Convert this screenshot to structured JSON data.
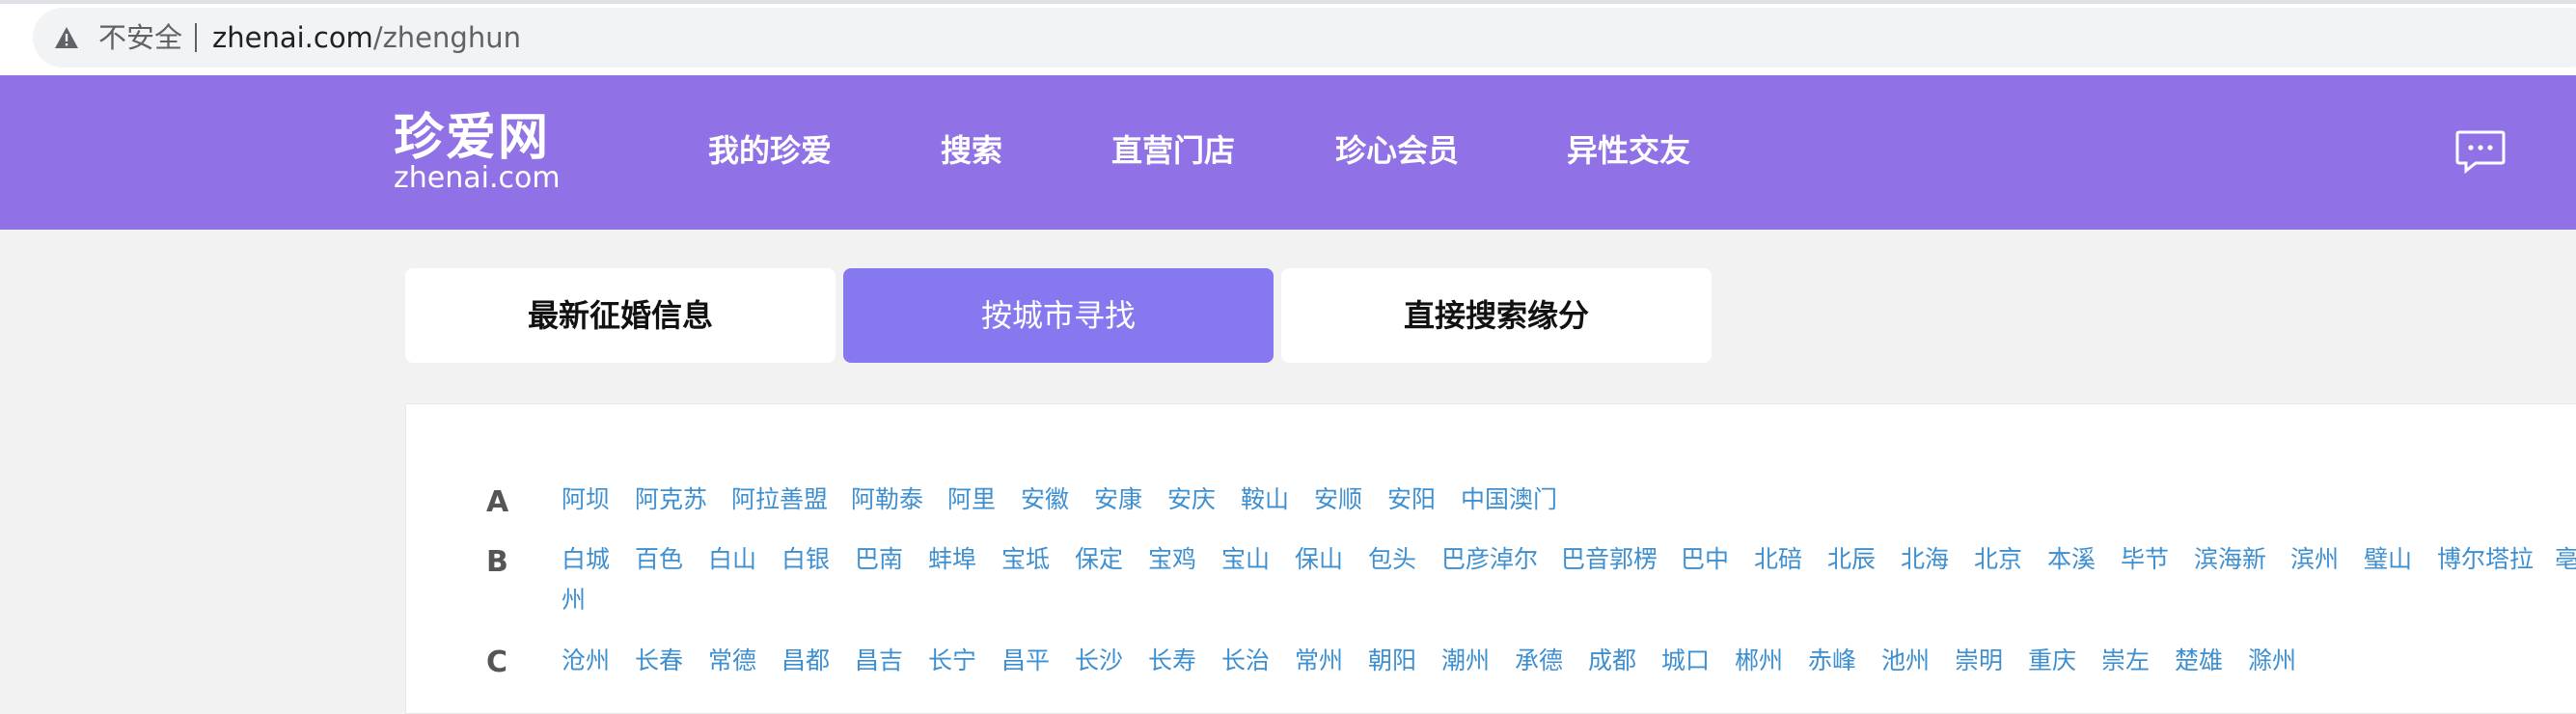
{
  "browser": {
    "security_label": "不安全",
    "url_host": "zhenai.com",
    "url_path": "/zhenghun"
  },
  "header": {
    "logo_cn": "珍爱网",
    "logo_en": "zhenai.com",
    "nav": [
      "我的珍爱",
      "搜索",
      "直营门店",
      "珍心会员",
      "异性交友"
    ],
    "bg_color": "#9171e6"
  },
  "tabs": [
    {
      "label": "最新征婚信息",
      "active": false
    },
    {
      "label": "按城市寻找",
      "active": true
    },
    {
      "label": "直接搜索缘分",
      "active": false
    }
  ],
  "cities": {
    "A": [
      "阿坝",
      "阿克苏",
      "阿拉善盟",
      "阿勒泰",
      "阿里",
      "安徽",
      "安康",
      "安庆",
      "鞍山",
      "安顺",
      "安阳",
      "中国澳门"
    ],
    "B": [
      "白城",
      "百色",
      "白山",
      "白银",
      "巴南",
      "蚌埠",
      "宝坻",
      "保定",
      "宝鸡",
      "宝山",
      "保山",
      "包头",
      "巴彦淖尔",
      "巴音郭楞",
      "巴中",
      "北碚",
      "北辰",
      "北海",
      "北京",
      "本溪",
      "毕节",
      "滨海新",
      "滨州",
      "璧山",
      "博尔塔拉",
      "亳",
      "州"
    ],
    "C": [
      "沧州",
      "长春",
      "常德",
      "昌都",
      "昌吉",
      "长宁",
      "昌平",
      "长沙",
      "长寿",
      "长治",
      "常州",
      "朝阳",
      "潮州",
      "承德",
      "成都",
      "城口",
      "郴州",
      "赤峰",
      "池州",
      "崇明",
      "重庆",
      "崇左",
      "楚雄",
      "滁州"
    ]
  },
  "colors": {
    "link": "#3e8fd0",
    "active_tab": "#8679f0"
  }
}
